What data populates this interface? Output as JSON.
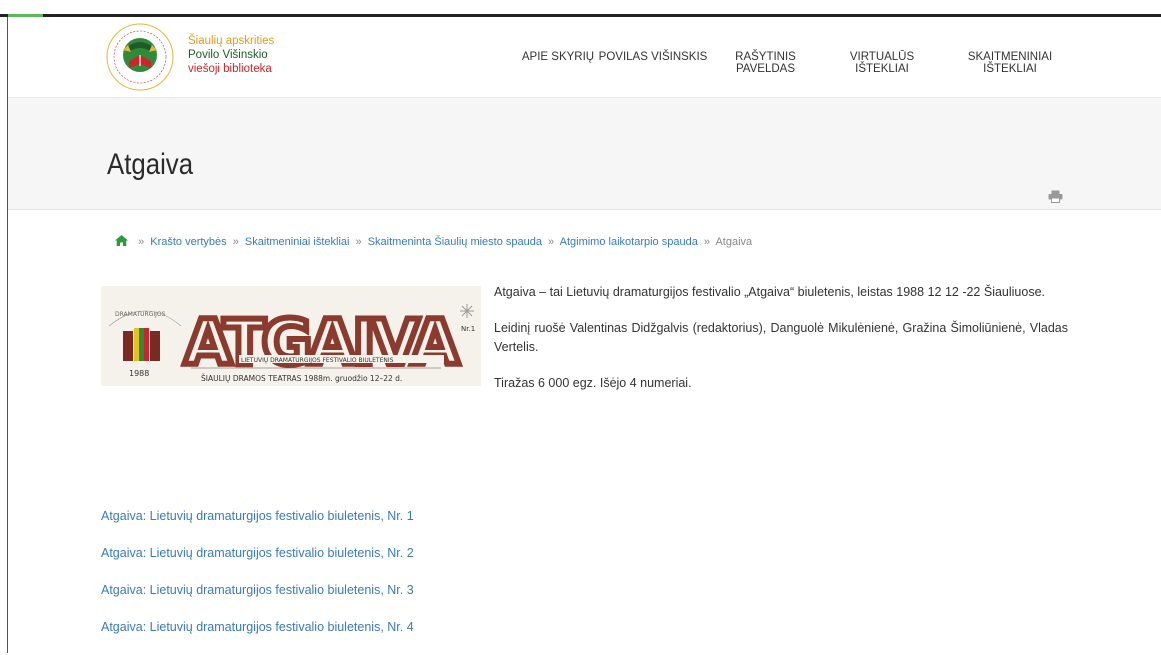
{
  "logo": {
    "line1": "Šiaulių apskrities",
    "line2": "Povilo Višinskio",
    "line3": "viešoji biblioteka"
  },
  "nav": {
    "items": [
      {
        "label": "APIE SKYRIŲ"
      },
      {
        "label": "POVILAS VIŠINSKIS"
      },
      {
        "label": "RAŠYTINIS PAVELDAS"
      },
      {
        "label": "VIRTUALŪS IŠTEKLIAI"
      },
      {
        "label": "SKAITMENINIAI IŠTEKLIAI"
      }
    ]
  },
  "page": {
    "title": "Atgaiva"
  },
  "breadcrumb": {
    "items": [
      {
        "label": "Krašto vertybės"
      },
      {
        "label": "Skaitmeniniai ištekliai"
      },
      {
        "label": "Skaitmeninta Šiaulių miesto spauda"
      },
      {
        "label": "Atgimimo laikotarpio spauda"
      }
    ],
    "current": "Atgaiva",
    "separator": "»"
  },
  "banner": {
    "masthead": "ATGAIVA",
    "subtitle": "LIETUVIŲ DRAMATURGIJOS FESTIVALIO BIULETENIS",
    "footer": "ŠIAULIŲ DRAMOS TEATRAS  1988m. gruodžio  12–22 d.",
    "number": "Nr.1",
    "year": "1988"
  },
  "description": {
    "p1": "Atgaiva – tai Lietuvių dramaturgijos festivalio „Atgaiva“ biuletenis, leistas 1988 12 12 -22 Šiauliuose.",
    "p2": "Leidinį ruošė Valentinas Didžgalvis (redaktorius), Danguolė Mikulėnienė, Gražina Šimoliūnienė, Vladas Vertelis.",
    "p3": "Tiražas 6 000 egz. Išėjo 4 numeriai."
  },
  "issues": [
    {
      "label": "Atgaiva: Lietuvių dramaturgijos festivalio biuletenis, Nr. 1"
    },
    {
      "label": "Atgaiva: Lietuvių dramaturgijos festivalio biuletenis, Nr. 2"
    },
    {
      "label": "Atgaiva: Lietuvių dramaturgijos festivalio biuletenis, Nr. 3"
    },
    {
      "label": "Atgaiva: Lietuvių dramaturgijos festivalio biuletenis, Nr. 4"
    }
  ],
  "colors": {
    "link": "#3a7ab8",
    "accent_green": "#5cb85c",
    "banner_brown": "#8b3a2e"
  },
  "icons": {
    "home": "home-icon",
    "print": "print-icon"
  }
}
